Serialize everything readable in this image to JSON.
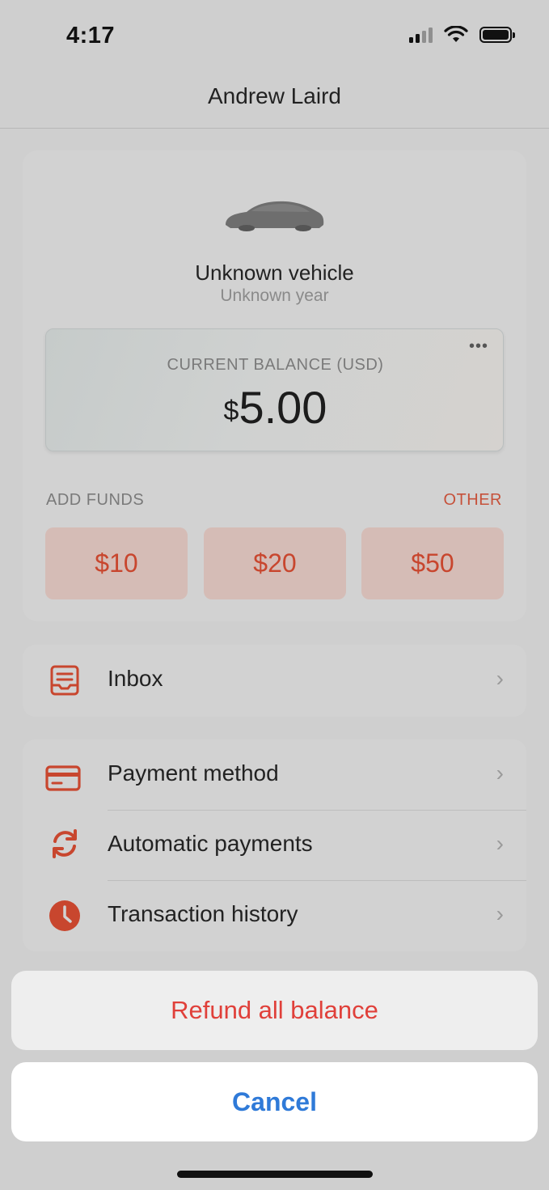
{
  "status_bar": {
    "time": "4:17"
  },
  "header": {
    "title": "Andrew Laird"
  },
  "vehicle": {
    "name": "Unknown vehicle",
    "year": "Unknown year",
    "icon": "car-silhouette-icon"
  },
  "balance": {
    "label": "CURRENT BALANCE (USD)",
    "currency_symbol": "$",
    "amount": "5.00",
    "more_icon": "ellipsis-icon"
  },
  "add_funds": {
    "label": "ADD FUNDS",
    "other_label": "OTHER",
    "amounts": [
      "$10",
      "$20",
      "$50"
    ]
  },
  "inbox": {
    "label": "Inbox",
    "icon": "inbox-icon"
  },
  "menu": {
    "items": [
      {
        "label": "Payment method",
        "icon": "credit-card-icon"
      },
      {
        "label": "Automatic payments",
        "icon": "refresh-icon"
      },
      {
        "label": "Transaction history",
        "icon": "clock-icon"
      }
    ]
  },
  "action_sheet": {
    "refund_label": "Refund all balance",
    "cancel_label": "Cancel"
  },
  "colors": {
    "accent": "#c8462e",
    "destructive": "#e0403a",
    "cancel": "#2f7ad8"
  }
}
